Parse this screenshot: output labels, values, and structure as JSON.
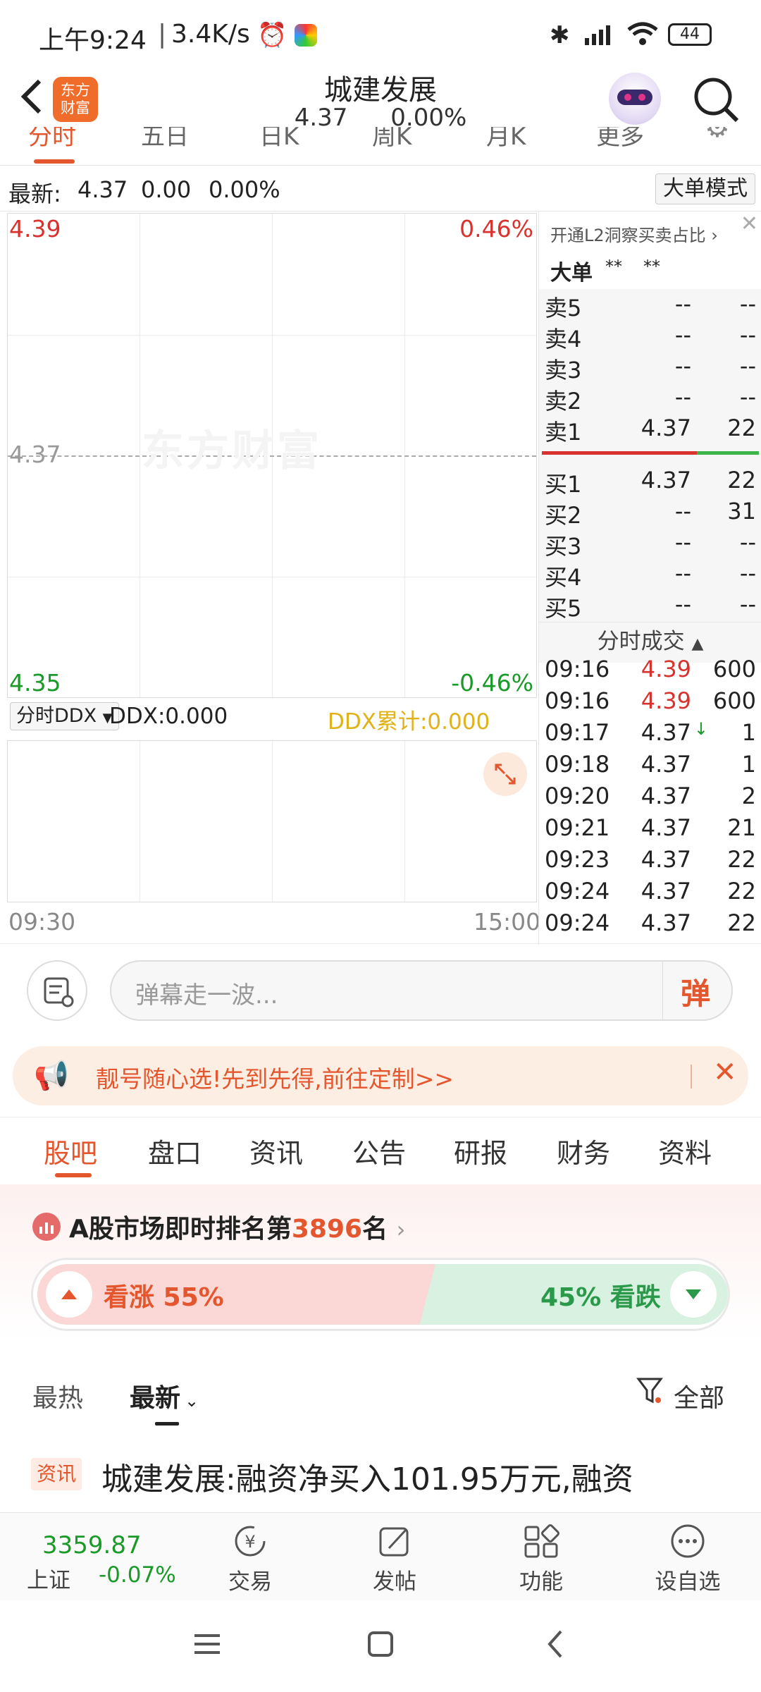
{
  "status_bar": {
    "time": "上午9:24",
    "net_speed": "3.4K/s",
    "battery": "44"
  },
  "header": {
    "back_icon": "chevron-left-icon",
    "app_logo": "东方\n财富",
    "title": "城建发展",
    "price": "4.37",
    "change": "0.00%"
  },
  "chart_tabs": [
    "分时",
    "五日",
    "日K",
    "周K",
    "月K",
    "更多"
  ],
  "quote": {
    "label": "最新:",
    "price": "4.37",
    "change": "0.00",
    "pct": "0.00%",
    "mode_button": "大单模式"
  },
  "intraday_chart": {
    "high": "4.39",
    "high_pct": "0.46%",
    "mid": "4.37",
    "low": "4.35",
    "low_pct": "-0.46%",
    "watermark": "东方财富",
    "start_time": "09:30",
    "end_time": "15:00"
  },
  "ddx": {
    "select": "分时DDX",
    "value": "DDX:0.000",
    "cumulative": "DDX累计:0.000"
  },
  "order_book": {
    "promo": "开通L2洞察买卖占比",
    "big_order_label": "大单",
    "big_order_v1": "**",
    "big_order_v2": "**",
    "asks": [
      {
        "label": "卖5",
        "price": "--",
        "vol": "--"
      },
      {
        "label": "卖4",
        "price": "--",
        "vol": "--"
      },
      {
        "label": "卖3",
        "price": "--",
        "vol": "--"
      },
      {
        "label": "卖2",
        "price": "--",
        "vol": "--"
      },
      {
        "label": "卖1",
        "price": "4.37",
        "vol": "22"
      }
    ],
    "bids": [
      {
        "label": "买1",
        "price": "4.37",
        "vol": "22"
      },
      {
        "label": "买2",
        "price": "--",
        "vol": "31"
      },
      {
        "label": "买3",
        "price": "--",
        "vol": "--"
      },
      {
        "label": "买4",
        "price": "--",
        "vol": "--"
      },
      {
        "label": "买5",
        "price": "--",
        "vol": "--"
      }
    ]
  },
  "trades": {
    "title": "分时成交",
    "rows": [
      {
        "time": "09:16",
        "price": "4.39",
        "vol": "600"
      },
      {
        "time": "09:16",
        "price": "4.39",
        "vol": "600"
      },
      {
        "time": "09:17",
        "price": "4.37",
        "vol": "1"
      },
      {
        "time": "09:18",
        "price": "4.37",
        "vol": "1"
      },
      {
        "time": "09:20",
        "price": "4.37",
        "vol": "2"
      },
      {
        "time": "09:21",
        "price": "4.37",
        "vol": "21"
      },
      {
        "time": "09:23",
        "price": "4.37",
        "vol": "22"
      },
      {
        "time": "09:24",
        "price": "4.37",
        "vol": "22"
      },
      {
        "time": "09:24",
        "price": "4.37",
        "vol": "22"
      }
    ]
  },
  "danmaku": {
    "placeholder": "弹幕走一波...",
    "button": "弹"
  },
  "banner": {
    "text": "靓号随心选!先到先得,前往定制>>"
  },
  "main_tabs": [
    "股吧",
    "盘口",
    "资讯",
    "公告",
    "研报",
    "财务",
    "资料"
  ],
  "ranking": {
    "prefix": "A股市场即时排名第",
    "rank": "3896",
    "suffix": "名"
  },
  "sentiment": {
    "up_label": "看涨 55%",
    "down_label": "45% 看跌",
    "up_fraction": 0.55
  },
  "feed": {
    "hot": "最热",
    "latest": "最新",
    "filter": "全部",
    "news_tag": "资讯",
    "news_title": "城建发展:融资净买入101.95万元,融资"
  },
  "bottom_nav": {
    "index_value": "3359.87",
    "index_name": "上证",
    "index_change": "-0.07%",
    "trade": "交易",
    "post": "发帖",
    "func": "功能",
    "watch": "设自选"
  }
}
